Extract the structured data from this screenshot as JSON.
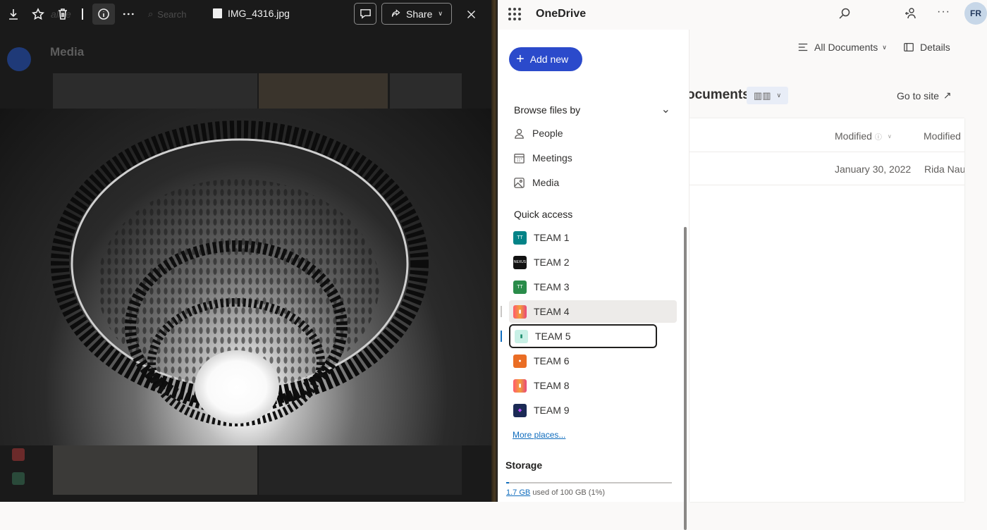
{
  "viewer": {
    "file_name": "IMG_4316.jpg",
    "search_placeholder": "Search",
    "share_label": "Share",
    "bg_title": "Media",
    "bg_brand": "alive",
    "toolbar_icons": [
      "download-icon",
      "star-icon",
      "trash-icon",
      "info-icon",
      "more-icon"
    ]
  },
  "onedrive": {
    "app_title": "OneDrive",
    "avatar_initials": "FR",
    "add_new_label": "Add new",
    "browse_section": "Browse files by",
    "browse_items": [
      {
        "label": "People",
        "icon": "person-icon"
      },
      {
        "label": "Meetings",
        "icon": "calendar-icon"
      },
      {
        "label": "Media",
        "icon": "image-icon"
      }
    ],
    "quick_access_label": "Quick access",
    "quick_access_items": [
      {
        "label": "TEAM 1",
        "color": "#038387"
      },
      {
        "label": "TEAM 2",
        "color": "#111111"
      },
      {
        "label": "TEAM 3",
        "color": "#2a8c4a"
      },
      {
        "label": "TEAM 4",
        "color": "#e8467c"
      },
      {
        "label": "TEAM 5",
        "color": "#c8f0e6"
      },
      {
        "label": "TEAM 6",
        "color": "#ea6d24"
      },
      {
        "label": "TEAM 8",
        "color": "#e8467c"
      },
      {
        "label": "TEAM 9",
        "color": "#1b2a55"
      }
    ],
    "more_places": "More places...",
    "storage_label": "Storage",
    "storage_used": "1.7 GB",
    "storage_rest": "used of 100 GB (1%)",
    "storage_fraction": 0.017,
    "view_label": "All Documents",
    "details_label": "Details",
    "library_title": "ocuments",
    "go_to_site": "Go to site",
    "col_modified": "Modified",
    "col_modified_by": "Modified",
    "row": {
      "modified": "January 30, 2022",
      "modified_by": "Rida Naus"
    },
    "accent": "#2b4acb"
  }
}
